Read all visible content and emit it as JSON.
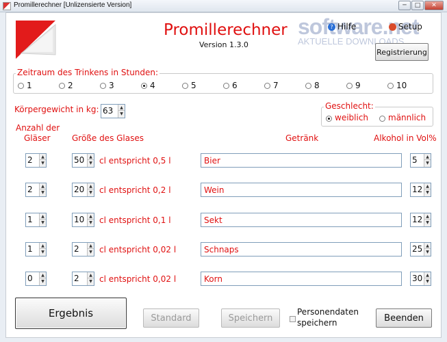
{
  "window": {
    "title": "Promillerechner [Unlizensierte Version]"
  },
  "header": {
    "title": "Promillerechner",
    "version": "Version 1.3.0",
    "watermark_main": "software.net",
    "watermark_sub": "AKTUELLE DOWNLOADS"
  },
  "menu": {
    "help": "Hilfe",
    "setup": "Setup"
  },
  "buttons": {
    "register": "Registrierung",
    "result": "Ergebnis",
    "standard": "Standard",
    "save": "Speichern",
    "exit": "Beenden"
  },
  "duration": {
    "label": "Zeitraum des Trinkens in Stunden:",
    "options": [
      "1",
      "2",
      "3",
      "4",
      "5",
      "6",
      "7",
      "8",
      "9",
      "10"
    ],
    "selected": "4"
  },
  "weight": {
    "label": "Körpergewicht in kg:",
    "value": "63"
  },
  "gender": {
    "label": "Geschlecht:",
    "female": "weiblich",
    "male": "männlich",
    "selected": "weiblich"
  },
  "columns": {
    "count_line1": "Anzahl der",
    "count_line2": "Gläser",
    "size": "Größe des Glases",
    "drink": "Getränk",
    "alcohol": "Alkohol in Vol%"
  },
  "rows": [
    {
      "count": "2",
      "size": "50",
      "equiv": "cl entspricht 0,5 l",
      "drink": "Bier",
      "alcohol": "5"
    },
    {
      "count": "2",
      "size": "20",
      "equiv": "cl entspricht 0,2 l",
      "drink": "Wein",
      "alcohol": "12"
    },
    {
      "count": "1",
      "size": "10",
      "equiv": "cl entspricht 0,1 l",
      "drink": "Sekt",
      "alcohol": "12"
    },
    {
      "count": "1",
      "size": "2",
      "equiv": "cl entspricht 0,02 l",
      "drink": "Schnaps",
      "alcohol": "25"
    },
    {
      "count": "0",
      "size": "2",
      "equiv": "cl entspricht 0,02 l",
      "drink": "Korn",
      "alcohol": "30"
    }
  ],
  "save_personal": {
    "line1": "Personendaten",
    "line2": "speichern"
  },
  "colors": {
    "accent_red": "#e01010",
    "background": "#ffffff"
  }
}
